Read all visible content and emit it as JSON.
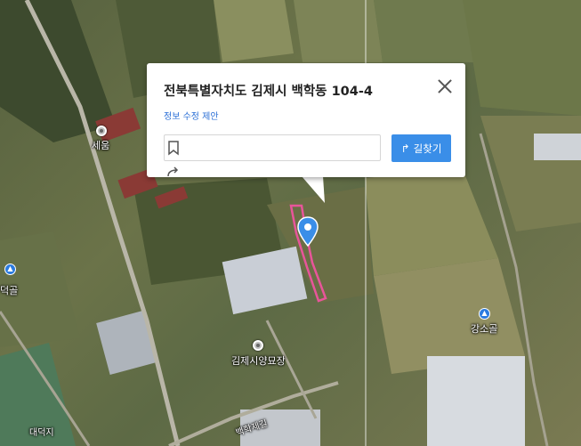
{
  "popup": {
    "title": "전북특별자치도 김제시 백학동 104-4",
    "edit_link": "정보 수정 제안",
    "directions_label": "길찾기",
    "bookmark_icon": "bookmark-icon",
    "share_icon": "share-icon",
    "close_icon": "close-icon"
  },
  "map": {
    "labels": {
      "poi_1": "세움",
      "poi_2": "김제시양묘장",
      "peak_1": "덕골",
      "peak_2": "강소골",
      "area_1": "대덕지",
      "road_1": "백학제길"
    },
    "marker_icon": "location-pin-icon",
    "boundary_color": "#e8559a",
    "accent_color": "#3a8ee8"
  }
}
